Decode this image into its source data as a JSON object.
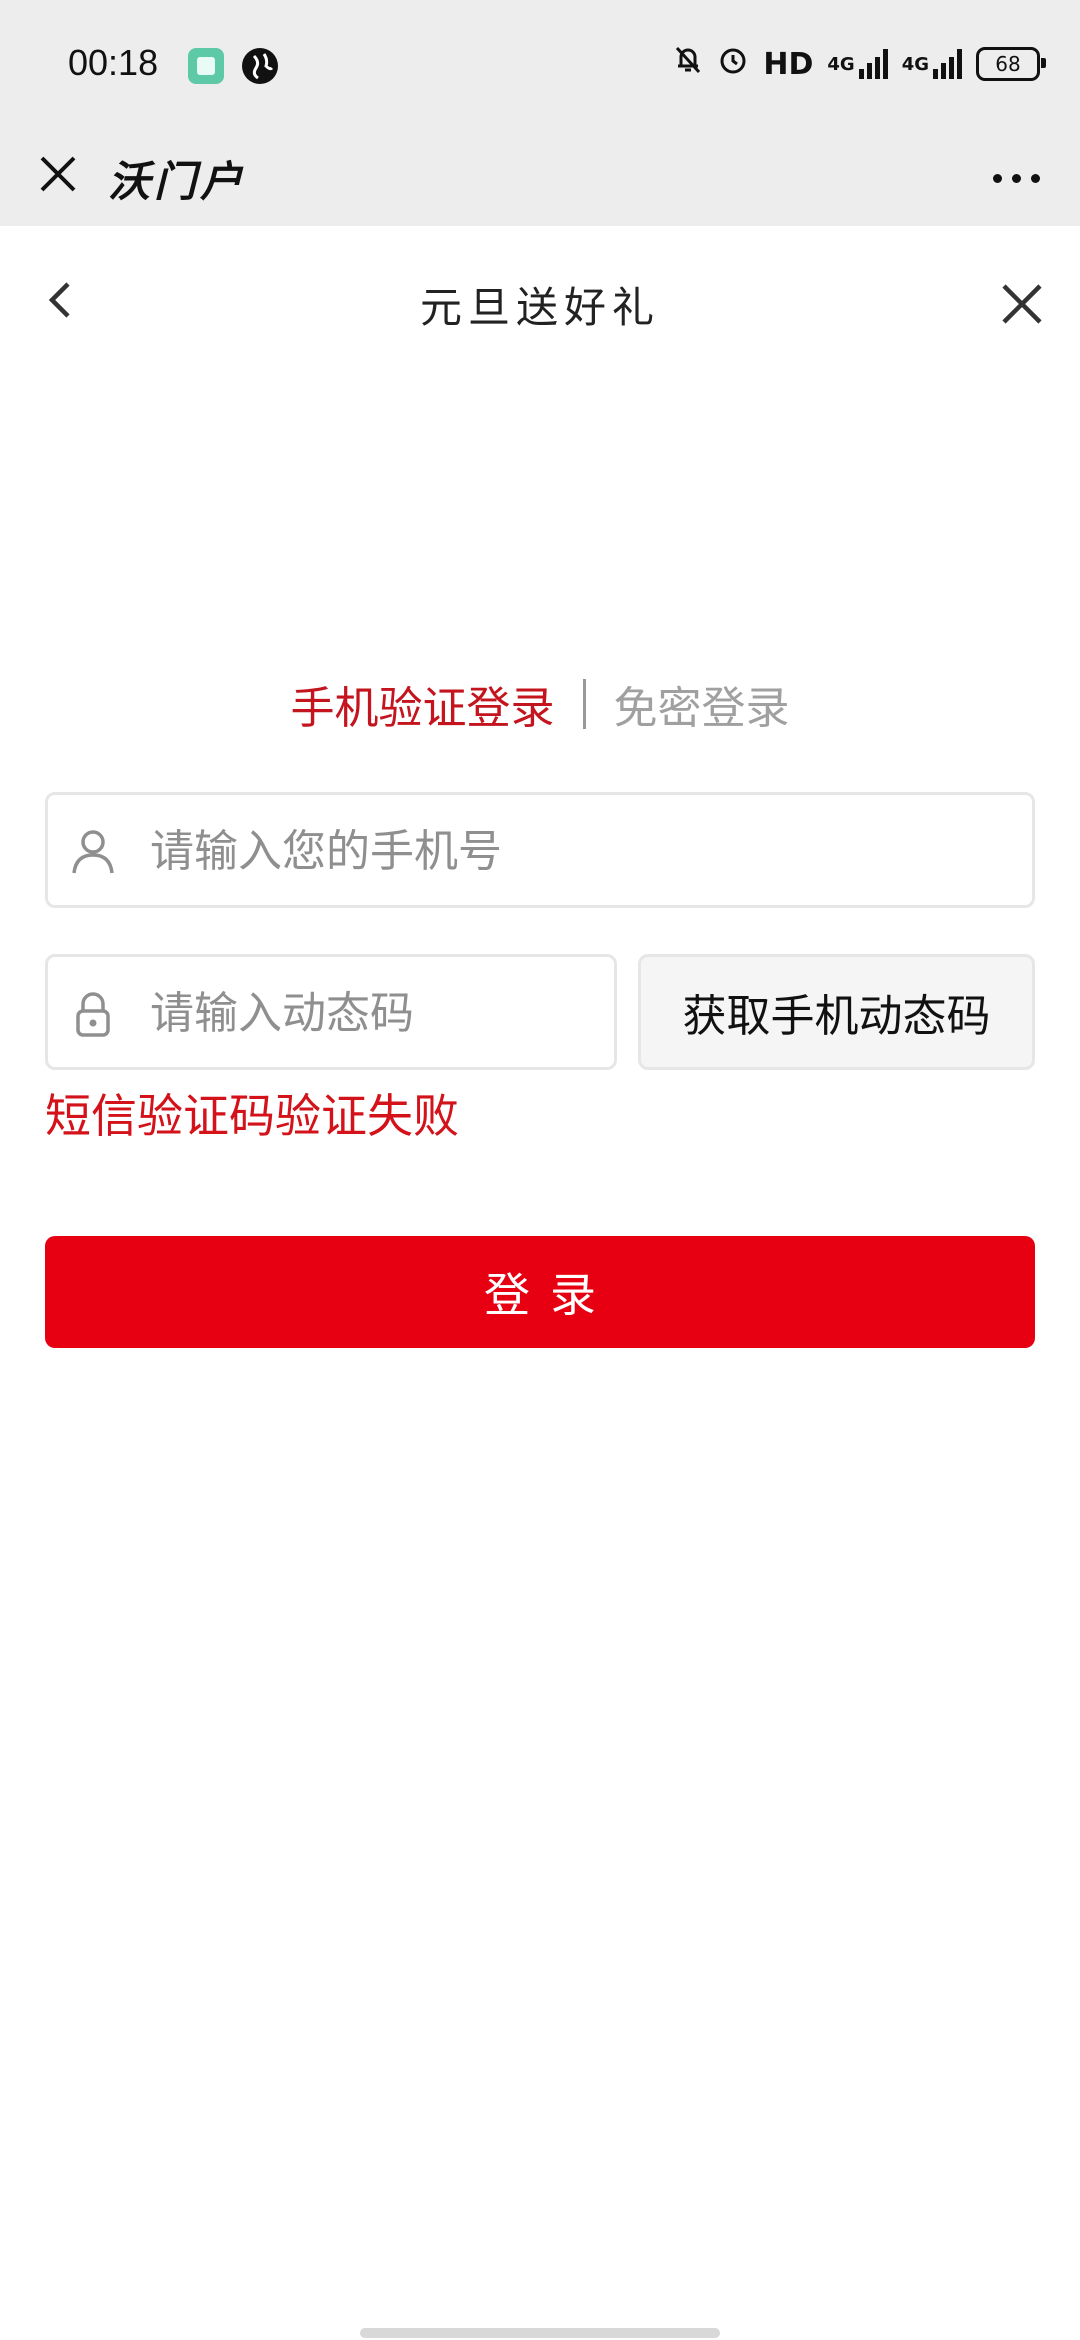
{
  "status_bar": {
    "time": "00:18",
    "hd": "HD",
    "net1": "4G",
    "net2": "4G",
    "battery": "68",
    "icons": [
      "app-badge-icon",
      "globe-icon",
      "mute-bell-icon",
      "alarm-icon",
      "signal-icon",
      "battery-icon"
    ]
  },
  "app_bar": {
    "title": "沃门户",
    "close_icon": "close-icon",
    "more_icon": "more-dots-icon"
  },
  "page": {
    "title": "元旦送好礼",
    "back_icon": "chevron-left-icon",
    "close_icon": "close-icon"
  },
  "login": {
    "tabs": [
      {
        "label": "手机验证登录",
        "active": true
      },
      {
        "label": "免密登录",
        "active": false
      }
    ],
    "phone_placeholder": "请输入您的手机号",
    "code_placeholder": "请输入动态码",
    "get_code_label": "获取手机动态码",
    "error_message": "短信验证码验证失败",
    "submit_label": "登录"
  },
  "colors": {
    "accent_red": "#e60012",
    "tab_active": "#c4141e",
    "error_red": "#d3121a",
    "chrome_gray": "#ededed"
  }
}
